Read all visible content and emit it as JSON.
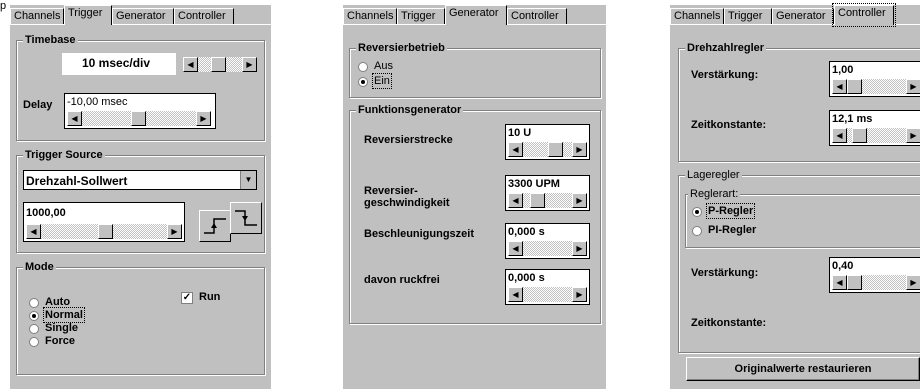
{
  "caption": "p",
  "tab_labels": [
    "Channels",
    "Trigger",
    "Generator",
    "Controller"
  ],
  "panel1": {
    "active_tab": "Trigger",
    "timebase": {
      "title": "Timebase",
      "value": "10 msec/div",
      "delay_label": "Delay",
      "delay_value": "-10,00 msec"
    },
    "trigger_source": {
      "title": "Trigger Source",
      "selected": "Drehzahl-Sollwert",
      "value": "1000,00"
    },
    "mode": {
      "title": "Mode",
      "options": [
        "Auto",
        "Normal",
        "Single",
        "Force"
      ],
      "selected": "Normal",
      "run_label": "Run",
      "run_checked": true
    }
  },
  "panel2": {
    "active_tab": "Generator",
    "reversierbetrieb": {
      "title": "Reversierbetrieb",
      "options": [
        "Aus",
        "Ein"
      ],
      "selected": "Ein"
    },
    "funktionsgenerator": {
      "title": "Funktionsgenerator",
      "fields": [
        {
          "label": "Reversierstrecke",
          "value": "10 U"
        },
        {
          "label_line1": "Reversier-",
          "label_line2": "geschwindigkeit",
          "value": "3300 UPM"
        },
        {
          "label": "Beschleunigungszeit",
          "value": "0,000 s"
        },
        {
          "label": "davon ruckfrei",
          "value": "0,000 s"
        }
      ]
    }
  },
  "panel3": {
    "active_tab": "Controller",
    "drehzahlregler": {
      "title": "Drehzahlregler",
      "verstaerkung_label": "Verstärkung:",
      "verstaerkung_value": "1,00",
      "zeitkonstante_label": "Zeitkonstante:",
      "zeitkonstante_value": "12,1 ms"
    },
    "lageregler": {
      "title": "Lageregler",
      "reglerart_title": "Reglerart:",
      "options": [
        "P-Regler",
        "PI-Regler"
      ],
      "selected": "P-Regler",
      "verstaerkung_label": "Verstärkung:",
      "verstaerkung_value": "0,40",
      "zeitkonstante_label": "Zeitkonstante:"
    },
    "restore_button": "Originalwerte restaurieren"
  }
}
